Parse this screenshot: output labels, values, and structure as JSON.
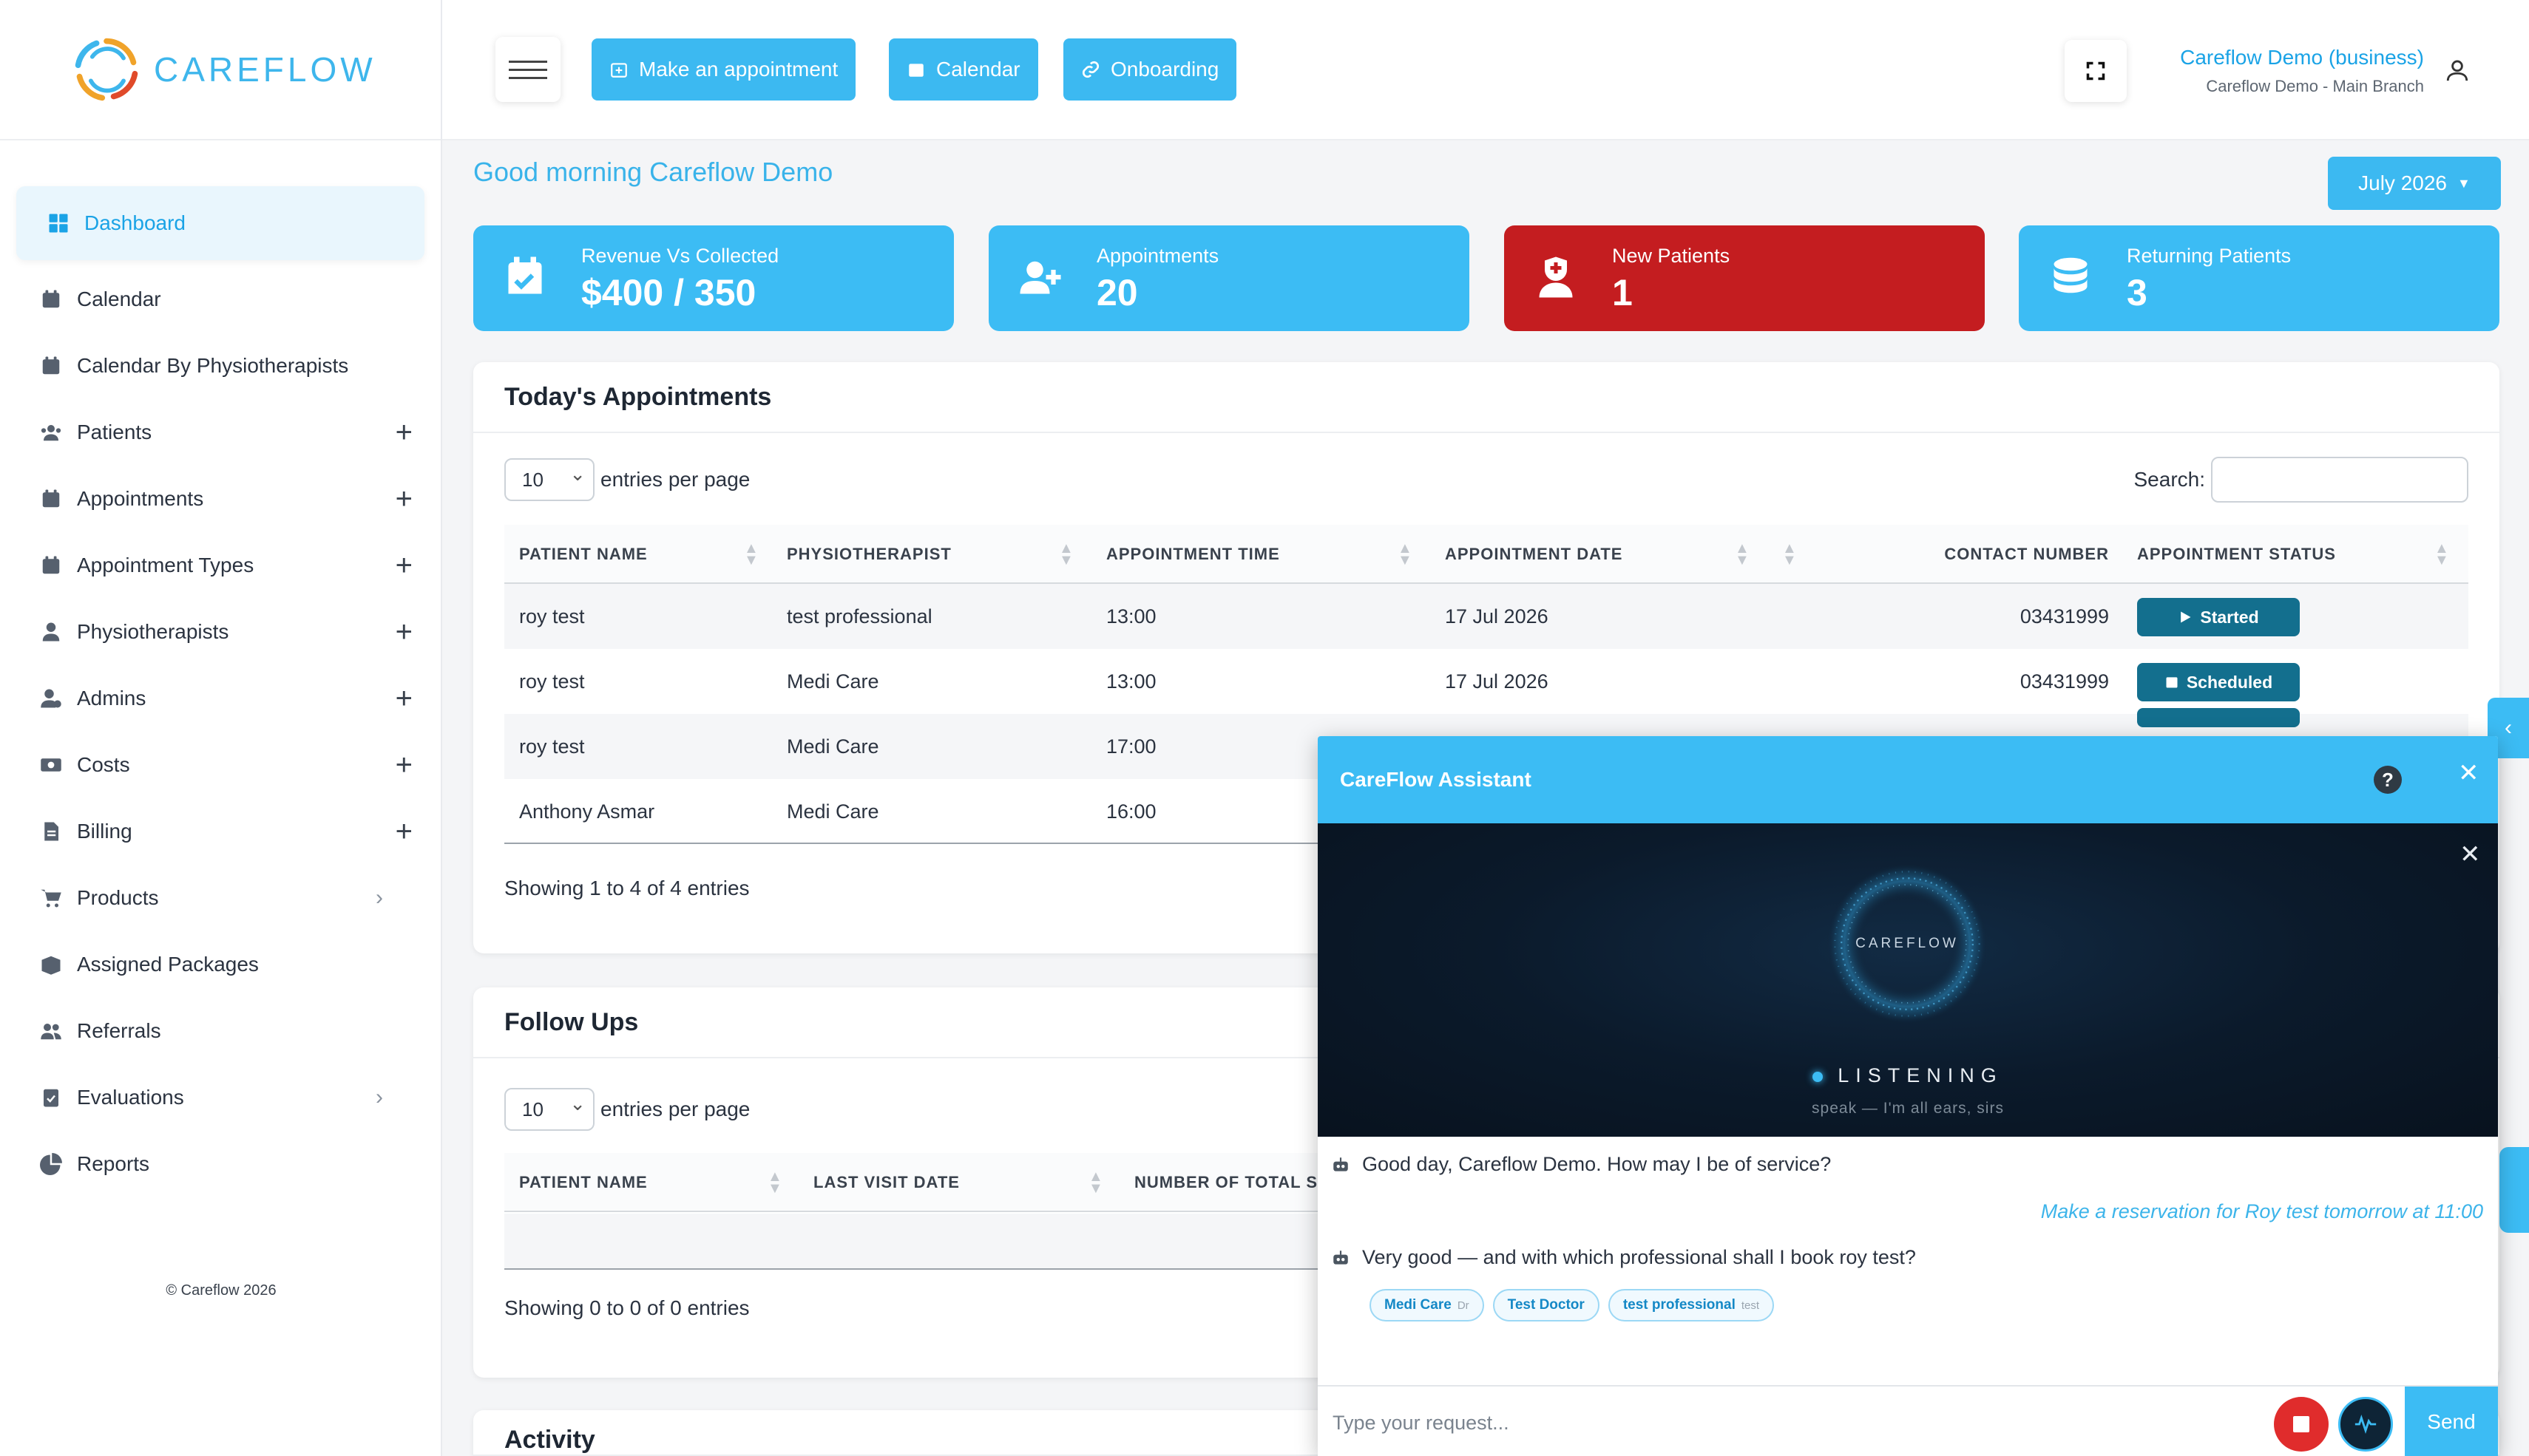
{
  "brand": {
    "name": "CAREFLOW"
  },
  "sidebar": {
    "items": [
      {
        "label": "Dashboard",
        "icon": "dashboard-icon",
        "trail": ""
      },
      {
        "label": "Calendar",
        "icon": "calendar-icon",
        "trail": ""
      },
      {
        "label": "Calendar By Physiotherapists",
        "icon": "calendar-icon",
        "trail": ""
      },
      {
        "label": "Patients",
        "icon": "users-icon",
        "trail": "+"
      },
      {
        "label": "Appointments",
        "icon": "calendar-plus-icon",
        "trail": "+"
      },
      {
        "label": "Appointment Types",
        "icon": "calendar-plus-icon",
        "trail": "+"
      },
      {
        "label": "Physiotherapists",
        "icon": "user-doctor-icon",
        "trail": "+"
      },
      {
        "label": "Admins",
        "icon": "user-gear-icon",
        "trail": "+"
      },
      {
        "label": "Costs",
        "icon": "money-icon",
        "trail": "+"
      },
      {
        "label": "Billing",
        "icon": "file-invoice-icon",
        "trail": "+"
      },
      {
        "label": "Products",
        "icon": "cart-icon",
        "trail": "›"
      },
      {
        "label": "Assigned Packages",
        "icon": "box-icon",
        "trail": ""
      },
      {
        "label": "Referrals",
        "icon": "user-group-icon",
        "trail": ""
      },
      {
        "label": "Evaluations",
        "icon": "clipboard-check-icon",
        "trail": "›"
      },
      {
        "label": "Reports",
        "icon": "chart-pie-icon",
        "trail": ""
      }
    ],
    "copyright": "© Careflow 2026"
  },
  "topbar": {
    "buttons": [
      "Make an appointment",
      "Calendar",
      "Onboarding"
    ],
    "user_name": "Careflow Demo (business)",
    "user_branch": "Careflow Demo - Main Branch"
  },
  "greeting": "Good morning Careflow Demo",
  "month_selector": "July 2026",
  "stats": [
    {
      "label": "Revenue Vs Collected",
      "value": "$400 / 350",
      "color": "#3cbcf4"
    },
    {
      "label": "Appointments",
      "value": "20",
      "color": "#3cbcf4"
    },
    {
      "label": "New Patients",
      "value": "1",
      "color": "#c41d20"
    },
    {
      "label": "Returning Patients",
      "value": "3",
      "color": "#3cbcf4"
    }
  ],
  "today": {
    "title": "Today's Appointments",
    "page_length": "10",
    "entries_label": "entries per page",
    "search_label": "Search:",
    "columns": [
      "PATIENT NAME",
      "PHYSIOTHERAPIST",
      "APPOINTMENT TIME",
      "APPOINTMENT DATE",
      "CONTACT NUMBER",
      "APPOINTMENT STATUS"
    ],
    "rows": [
      {
        "patient": "roy test",
        "physio": "test professional",
        "time": "13:00",
        "date": "17 Jul 2026",
        "contact": "03431999",
        "status": "Started"
      },
      {
        "patient": "roy test",
        "physio": "Medi Care",
        "time": "13:00",
        "date": "17 Jul 2026",
        "contact": "03431999",
        "status": "Scheduled"
      },
      {
        "patient": "roy test",
        "physio": "Medi Care",
        "time": "17:00",
        "date": "",
        "contact": "",
        "status": ""
      },
      {
        "patient": "Anthony Asmar",
        "physio": "Medi Care",
        "time": "16:00",
        "date": "",
        "contact": "",
        "status": ""
      }
    ],
    "info": "Showing 1 to 4 of 4 entries"
  },
  "followups": {
    "title": "Follow Ups",
    "page_length": "10",
    "entries_label": "entries per page",
    "columns": [
      "PATIENT NAME",
      "LAST VISIT DATE",
      "NUMBER OF TOTAL S"
    ],
    "info": "Showing 0 to 0 of 0 entries"
  },
  "activity": {
    "title": "Activity"
  },
  "assistant": {
    "title": "CareFlow Assistant",
    "orb_label": "CAREFLOW",
    "status": "LISTENING",
    "status_sub": "speak — I'm all ears, sirs",
    "messages": [
      {
        "from": "bot",
        "text": "Good day, Careflow Demo. How may I be of service?"
      },
      {
        "from": "user",
        "text": "Make a reservation for Roy test tomorrow at 11:00"
      },
      {
        "from": "bot",
        "text": "Very good — and with which professional shall I book roy test?"
      }
    ],
    "chips": [
      {
        "label": "Medi Care",
        "sub": "Dr"
      },
      {
        "label": "Test Doctor",
        "sub": ""
      },
      {
        "label": "test professional",
        "sub": "test"
      }
    ],
    "input_placeholder": "Type your request...",
    "send_label": "Send"
  }
}
